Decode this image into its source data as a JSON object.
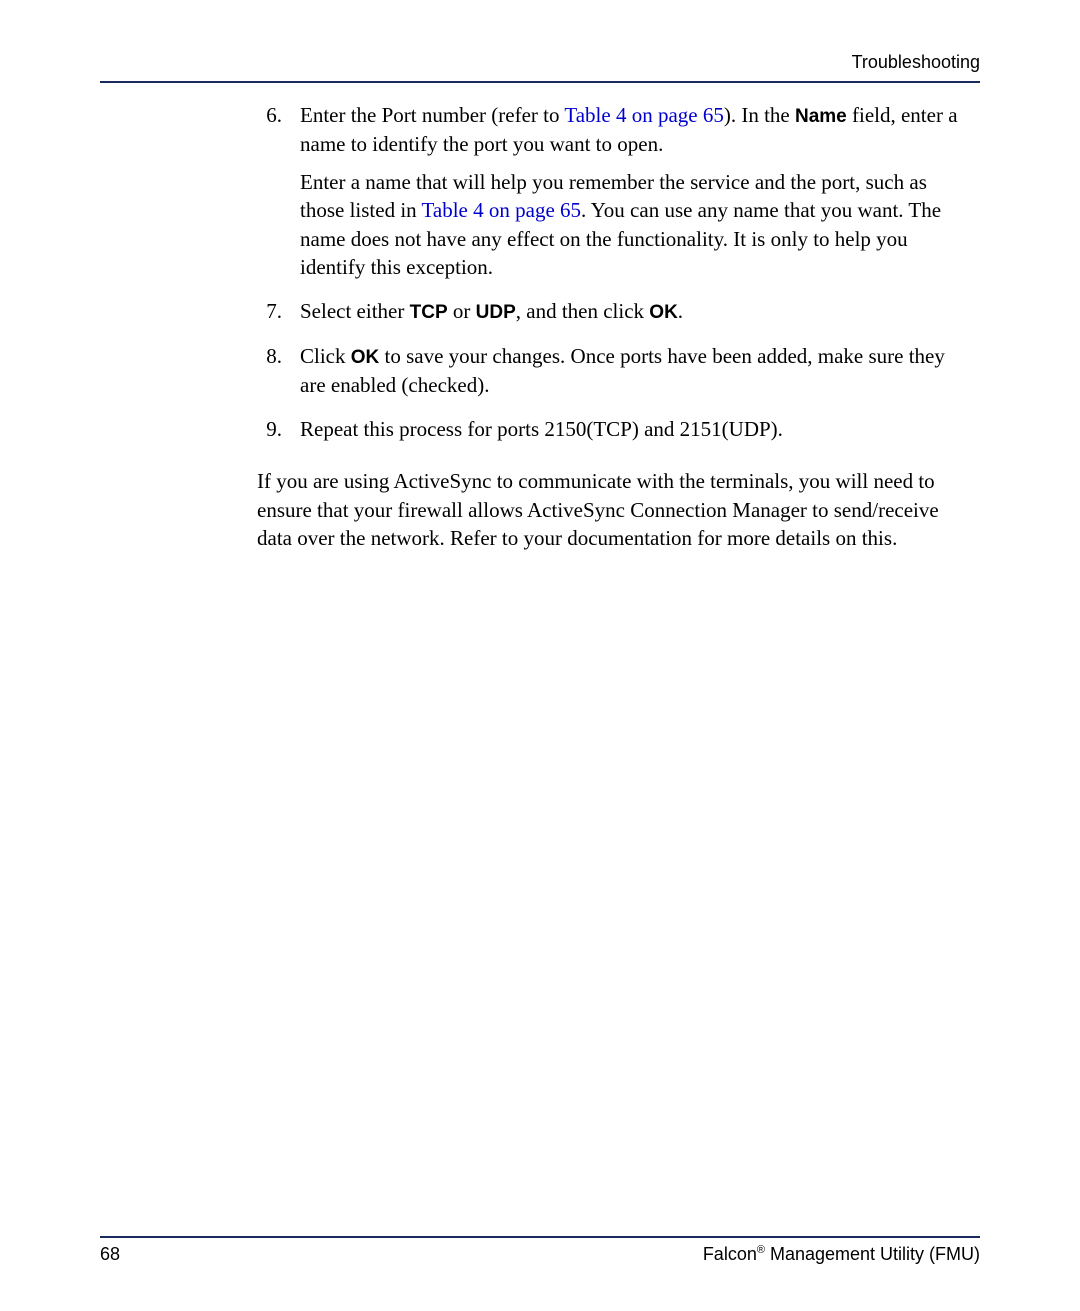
{
  "header": {
    "title": "Troubleshooting"
  },
  "steps": [
    {
      "num": "6.",
      "p1_pre": "Enter the Port number (refer to ",
      "p1_link": "Table 4 on page 65",
      "p1_mid": "). In the ",
      "p1_bold": "Name",
      "p1_post": " field, enter a name to identify the port you want to open.",
      "p2_pre": "Enter a name that will help you remember the service and the port, such as those listed in ",
      "p2_link": "Table 4 on page 65",
      "p2_post": ". You can use any name that you want. The name does not have any effect on the functionality. It is only to help you identify this exception."
    },
    {
      "num": "7.",
      "pre": "Select either ",
      "b1": "TCP",
      "mid1": " or ",
      "b2": "UDP",
      "mid2": ", and then click ",
      "b3": "OK",
      "post": "."
    },
    {
      "num": "8.",
      "pre": "Click ",
      "b1": "OK",
      "post": " to save your changes. Once ports have been added, make sure they are enabled (checked)."
    },
    {
      "num": "9.",
      "text": "Repeat this process for ports 2150(TCP) and 2151(UDP)."
    }
  ],
  "paragraph": "If you are using ActiveSync to communicate with the terminals, you will need to ensure that your firewall allows ActiveSync Connection Manager to send/receive data over the network. Refer to your documentation for more details on this.",
  "footer": {
    "page": "68",
    "product_pre": "Falcon",
    "product_sup": "®",
    "product_post": " Management Utility (FMU)"
  }
}
